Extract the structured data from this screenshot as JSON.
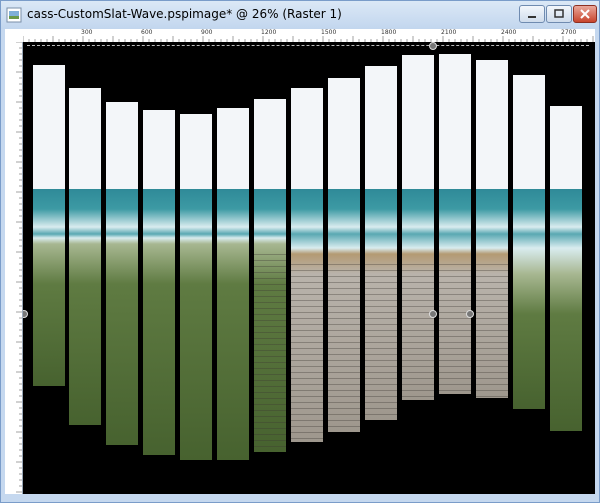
{
  "window": {
    "title": "cass-CustomSlat-Wave.pspimage* @  26% (Raster 1)",
    "buttons": [
      "minimize",
      "maximize",
      "close"
    ]
  },
  "ruler": {
    "top_labels": [
      "300",
      "600",
      "900",
      "1200",
      "1500",
      "1800",
      "2100",
      "2400",
      "2700"
    ]
  },
  "canvas": {
    "background": "#000000",
    "image_description": "beach boardwalk cut into vertical slats"
  },
  "colors": {
    "sky": "#f3f6f9",
    "sea": "#3d9aa4",
    "surf": "#d9ecef",
    "grass": "#5f7b42",
    "sand": "#b49a73",
    "boardwalk": "#b9b3ab"
  }
}
